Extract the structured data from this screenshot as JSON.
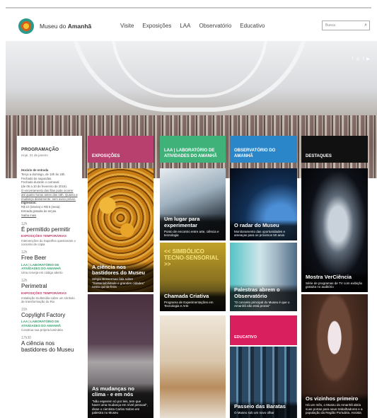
{
  "header": {
    "brand_prefix": "Museu do ",
    "brand_bold": "Amanhã",
    "nav": [
      "Visite",
      "Exposições",
      "LAA",
      "Observatório",
      "Educativo"
    ],
    "search_placeholder": "Busca"
  },
  "social": [
    "f",
    "◎",
    "t",
    "▶"
  ],
  "programacao": {
    "title": "PROGRAMAÇÃO",
    "date": "Hoje, 21 de janeiro",
    "info_title": "Horário de entrada",
    "info_lines": [
      "Terça a domingo, de 10h às 18h.",
      "Fechado às segundas.",
      "Fechado durante o carnaval",
      "(de 06 a 10 de fevereiro de 2016)."
    ],
    "info_link": "O encerramento das filas pode ocorrer até quatro horas antes das 18h. Quanto a mudança diariamente, sem aviso prévio.",
    "ingressos_title": "Ingressos:",
    "ingressos_lines": [
      "R$ 10 (inteira) e R$ 5 (meia).",
      "Entrada gratuita às terças.",
      "Saiba mais"
    ]
  },
  "events": [
    {
      "time": "12h",
      "name": "É permitido permitir",
      "cat": "EXPOSIÇÕES TEMPORÁRIAS",
      "cat_color": "#c0396b",
      "desc": "Intervenções do Superflex questionam o conceito de cópia"
    },
    {
      "time": "12h",
      "name": "Free Beer",
      "cat": "LAA | LABORATÓRIO DE ATIVIDADES DO AMANHÃ",
      "cat_color": "#3aa06e",
      "desc": "Uma cerveja em código aberto"
    },
    {
      "time": "12h",
      "name": "Perimetral",
      "cat": "EXPOSIÇÕES TEMPORÁRIAS",
      "cat_color": "#c0396b",
      "desc": "Instalação multimídia sobre um símbolo de transformação do Rio"
    },
    {
      "time": "15h",
      "name": "Copylight Factory",
      "cat": "LAA | LABORATÓRIO DE ATIVIDADES DO AMANHÃ",
      "cat_color": "#3aa06e",
      "desc": "Construa sua própria luminária"
    },
    {
      "time": "17h30",
      "name": "A ciência nos bastidores do Museu",
      "cat": "",
      "cat_color": "#c0396b",
      "desc": ""
    }
  ],
  "columns": [
    {
      "label": "EXPOSIÇÕES",
      "color": "#b8406e"
    },
    {
      "label": "LAA | LABORATÓRIO DE ATIVIDADES DO AMANHÃ",
      "color": "#3fb27a"
    },
    {
      "label": "OBSERVATÓRIO DO AMANHÃ",
      "color": "#2a86c9"
    },
    {
      "label": "DESTAQUES",
      "color": "#111111"
    }
  ],
  "cards": [
    {
      "title": "A ciência nos bastidores do Museu",
      "desc": "Sérgio Besserman fala sobre \"Sustentabilidade e grandes cidades\" nesta quinta-feira"
    },
    {
      "title": "As mudanças no clima - e em nós",
      "desc": "\"Não esperem só por leis, tem que haver uma mudança em nível pessoal\", disse o cientista Carlos Nobre em palestra no Museu"
    },
    {
      "title": "Um lugar para experimentar",
      "desc": "Ponto de encontro entre arte, ciência e tecnologia"
    },
    {
      "title": "Chamada Criativa",
      "desc": "Programa de Experimentações em Tecnologia e Arte",
      "banner": "<< SIMBÓLICO TECNO-SENSORIAL >>"
    },
    {
      "title": "O radar do Museu",
      "desc": "Monitoramento das oportunidades e ameaças para os próximos 50 anos"
    },
    {
      "title": "Palestras abrem o Observatório",
      "desc": "\"O conceito principal do Museu é que o Amanhã não está pronto\""
    },
    {
      "title": "Passeio das Baratas",
      "desc": "O Museu sob um novo olhar",
      "label": "EDUCATIVO"
    },
    {
      "title": "Mostra VerCiência",
      "desc": "Série de programas de TV com exibição gratuita no auditório"
    },
    {
      "title": "Os vizinhos primeiro",
      "desc": "Há um mês, o Museu do Amanhã abria suas portas para seus trabalhadores e a população da Região Portuária. Assista"
    }
  ]
}
